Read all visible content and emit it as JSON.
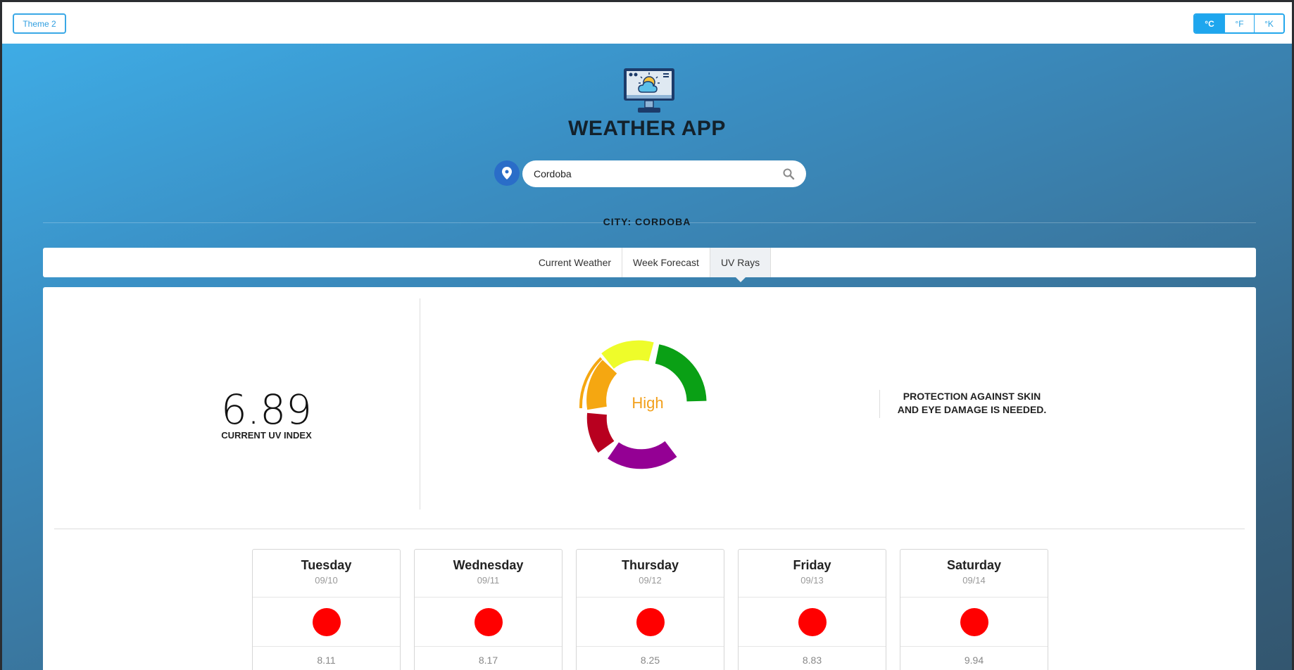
{
  "topbar": {
    "theme_label": "Theme 2",
    "units": [
      "°C",
      "°F",
      "°K"
    ],
    "active_unit": "°C"
  },
  "header": {
    "title": "WEATHER APP"
  },
  "search": {
    "value": "Cordoba",
    "placeholder": ""
  },
  "city": {
    "label": "CITY: CORDOBA"
  },
  "tabs": [
    {
      "label": "Current Weather",
      "active": false
    },
    {
      "label": "Week Forecast",
      "active": false
    },
    {
      "label": "UV Rays",
      "active": true
    }
  ],
  "uv": {
    "value": "6.89",
    "caption": "CURRENT UV INDEX",
    "level": "High",
    "level_color": "#f2a01c",
    "advice_line1": "PROTECTION AGAINST SKIN",
    "advice_line2": "AND EYE DAMAGE IS NEEDED.",
    "gauge_colors": [
      "#0aa015",
      "#eefc2a",
      "#f5a711",
      "#b8001f",
      "#940094"
    ]
  },
  "forecast": [
    {
      "day": "Tuesday",
      "date": "09/10",
      "uv": "8.11"
    },
    {
      "day": "Wednesday",
      "date": "09/11",
      "uv": "8.17"
    },
    {
      "day": "Thursday",
      "date": "09/12",
      "uv": "8.25"
    },
    {
      "day": "Friday",
      "date": "09/13",
      "uv": "8.83"
    },
    {
      "day": "Saturday",
      "date": "09/14",
      "uv": "9.94"
    }
  ]
}
